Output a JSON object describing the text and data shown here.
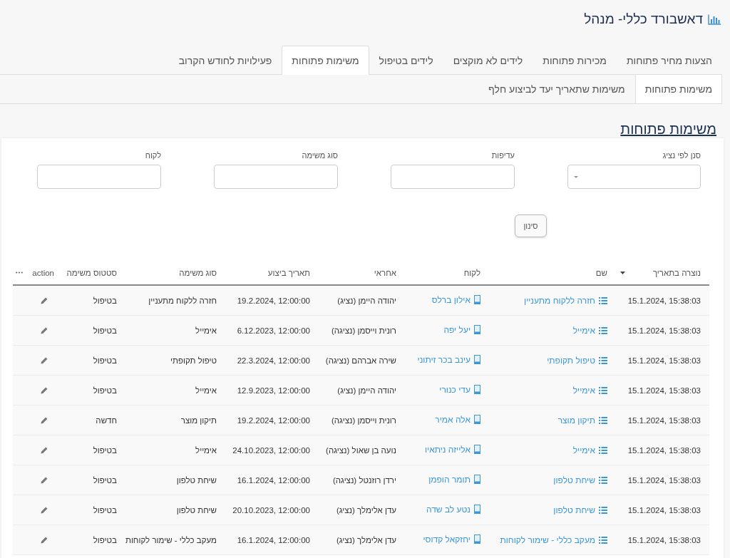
{
  "header": {
    "title": "דאשבורד כללי- מנהל"
  },
  "tabs": [
    {
      "label": "הצעות מחיר פתוחות",
      "selected": false
    },
    {
      "label": "מכירות פתוחות",
      "selected": false
    },
    {
      "label": "לידים לא מוקצים",
      "selected": false
    },
    {
      "label": "לידים בטיפול",
      "selected": false
    },
    {
      "label": "משימות פתוחות",
      "selected": true
    },
    {
      "label": "פעילויות לחודש הקרוב",
      "selected": false
    }
  ],
  "subtabs": [
    {
      "label": "משימות פתוחות",
      "selected": true
    },
    {
      "label": "משימות שתאריך יעד לביצוע חלף",
      "selected": false
    }
  ],
  "section_title": "משימות פתוחות",
  "filters": [
    {
      "label": "סנן לפי נציג",
      "kind": "select"
    },
    {
      "label": "עדיפות",
      "kind": "text"
    },
    {
      "label": "סוג משימה",
      "kind": "text"
    },
    {
      "label": "לקוח",
      "kind": "text"
    }
  ],
  "filter_button": "סינון",
  "table": {
    "columns": [
      {
        "label": "נוצרה בתאריך",
        "kind": "data",
        "sorted": true
      },
      {
        "label": "שם",
        "kind": "data",
        "sorted": false
      },
      {
        "label": "לקוח",
        "kind": "data",
        "sorted": false
      },
      {
        "label": "אחראי",
        "kind": "data",
        "sorted": false
      },
      {
        "label": "תאריך ביצוע",
        "kind": "data",
        "sorted": false
      },
      {
        "label": "סוג משימה",
        "kind": "data",
        "sorted": false
      },
      {
        "label": "סטטוס משימה",
        "kind": "data",
        "sorted": false
      },
      {
        "label": "action",
        "kind": "action",
        "sorted": false
      }
    ],
    "rows": [
      {
        "created": "15.1.2024, 15:38:03",
        "name": "חזרה ללקוח מתעניין",
        "customer": "אילון ברלס",
        "owner": "יהודה היימן (נציג)",
        "due": "19.2.2024, 12:00:00",
        "type": "חזרה ללקוח מתעניין",
        "status": "בטיפול"
      },
      {
        "created": "15.1.2024, 15:38:03",
        "name": "אימייל",
        "customer": "יעל יפה",
        "owner": "רונית וייסמן (נציגה)",
        "due": "6.12.2023, 12:00:00",
        "type": "אימייל",
        "status": "בטיפול"
      },
      {
        "created": "15.1.2024, 15:38:03",
        "name": "טיפול תקופתי",
        "customer": "עינב בכר זיתוני",
        "owner": "שירה אברהם (נציגה)",
        "due": "22.3.2024, 12:00:00",
        "type": "טיפול תקופתי",
        "status": "בטיפול"
      },
      {
        "created": "15.1.2024, 15:38:03",
        "name": "אימייל",
        "customer": "עדי כנורי",
        "owner": "יהודה היימן (נציג)",
        "due": "12.9.2023, 12:00:00",
        "type": "אימייל",
        "status": "בטיפול"
      },
      {
        "created": "15.1.2024, 15:38:03",
        "name": "תיקון מוצר",
        "customer": "אלה אמיר",
        "owner": "רונית וייסמן (נציגה)",
        "due": "19.2.2024, 12:00:00",
        "type": "תיקון מוצר",
        "status": "חדשה"
      },
      {
        "created": "15.1.2024, 15:38:03",
        "name": "אימייל",
        "customer": "אלייזה ניתאיו",
        "owner": "נועה בן שאול (נציגה)",
        "due": "24.10.2023, 12:00:00",
        "type": "אימייל",
        "status": "בטיפול"
      },
      {
        "created": "15.1.2024, 15:38:03",
        "name": "שיחת טלפון",
        "customer": "תומר הופמן",
        "owner": "ירדן רוזנטל (נציגה)",
        "due": "16.1.2024, 12:00:00",
        "type": "שיחת טלפון",
        "status": "בטיפול"
      },
      {
        "created": "15.1.2024, 15:38:03",
        "name": "שיחת טלפון",
        "customer": "נטע לב שדה",
        "owner": "עדן אלימלך (נציג)",
        "due": "20.10.2023, 12:00:00",
        "type": "שיחת טלפון",
        "status": "בטיפול"
      },
      {
        "created": "15.1.2024, 15:38:03",
        "name": "מעקב כללי - שימור לקוחות",
        "customer": "יחזקאל קדוסי",
        "owner": "עדן אלימלך (נציג)",
        "due": "16.1.2024, 12:00:00",
        "type": "מעקב כללי - שימור לקוחות",
        "status": "בטיפול"
      }
    ]
  }
}
